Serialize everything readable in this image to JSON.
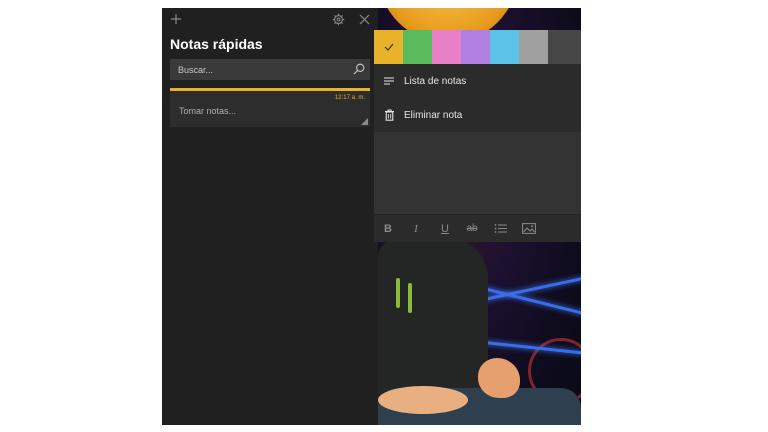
{
  "notes_panel": {
    "title": "Notas rápidas",
    "search": {
      "placeholder": "Buscar..."
    },
    "notes": [
      {
        "time": "12:17 a. m.",
        "text": "Tomar notas...",
        "color": "#e8b32a"
      }
    ],
    "icons": {
      "add": "plus-icon",
      "settings": "gear-icon",
      "close": "close-icon",
      "search": "search-icon"
    }
  },
  "note_window": {
    "colors": [
      {
        "name": "yellow",
        "hex": "#e8b32a",
        "selected": true
      },
      {
        "name": "green",
        "hex": "#5bba5b"
      },
      {
        "name": "pink",
        "hex": "#e97fc6"
      },
      {
        "name": "purple",
        "hex": "#b07fe0"
      },
      {
        "name": "blue",
        "hex": "#5cc2e8"
      },
      {
        "name": "gray",
        "hex": "#a0a0a0"
      },
      {
        "name": "charcoal",
        "hex": "#474747"
      }
    ],
    "menu": [
      {
        "label": "Lista de notas",
        "icon": "list-icon"
      },
      {
        "label": "Eliminar nota",
        "icon": "trash-icon"
      }
    ],
    "toolbar": {
      "bold": "B",
      "italic": "I",
      "underline": "U",
      "strikethrough": "ab",
      "icons": [
        "bold-icon",
        "italic-icon",
        "underline-icon",
        "strikethrough-icon",
        "bullet-list-icon",
        "image-icon"
      ]
    }
  }
}
